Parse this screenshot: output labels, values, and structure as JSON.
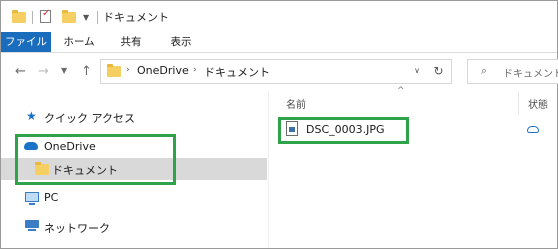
{
  "window": {
    "title": "ドキュメント"
  },
  "ribbon": {
    "tabs": [
      "ファイル",
      "ホーム",
      "共有",
      "表示"
    ]
  },
  "address": {
    "crumbs": [
      "OneDrive",
      "ドキュメント"
    ],
    "search_placeholder": "ドキュメントの検索"
  },
  "navpane": {
    "quick_access": "クイック アクセス",
    "onedrive": "OneDrive",
    "documents": "ドキュメント",
    "pc": "PC",
    "network": "ネットワーク"
  },
  "content": {
    "columns": {
      "name": "名前",
      "status": "状態"
    },
    "files": [
      {
        "name": "DSC_0003.JPG",
        "status": "cloud"
      }
    ]
  },
  "colors": {
    "accent": "#1a6dbd",
    "selection": "#d9d9d9",
    "annotation": "#2ea34a",
    "folder": "#f6cf62",
    "onedrive": "#1a73c9"
  }
}
